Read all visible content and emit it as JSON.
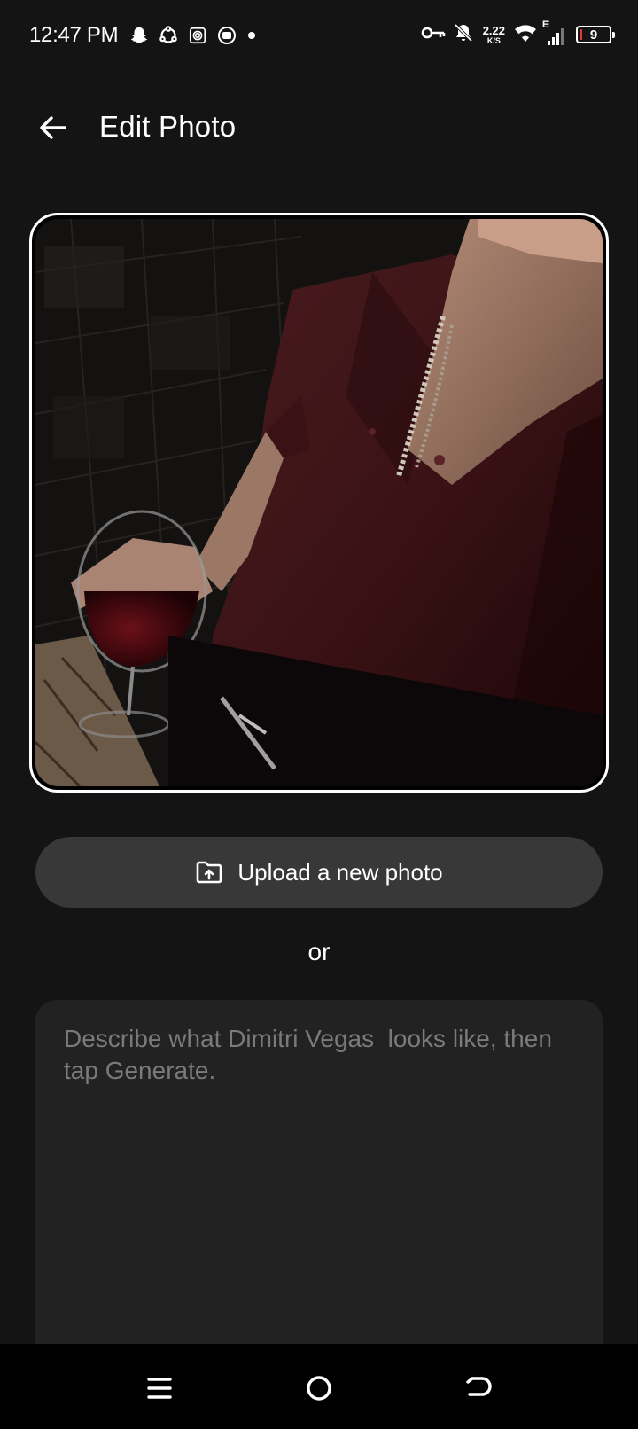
{
  "status_bar": {
    "time": "12:47 PM",
    "notification_icons": [
      "snapchat-icon",
      "sync-icon",
      "fingerprint-icon",
      "media-icon",
      "dot-icon"
    ],
    "network_speed_value": "2.22",
    "network_speed_unit": "K/S",
    "network_type": "E",
    "battery_level": "9",
    "battery_color": "#e53935"
  },
  "header": {
    "title": "Edit Photo",
    "back_icon": "arrow-left-icon"
  },
  "upload": {
    "label": "Upload a new photo",
    "icon": "folder-upload-icon"
  },
  "separator_text": "or",
  "description": {
    "value": "",
    "placeholder": "Describe what Dimitri Vegas  looks like, then tap Generate."
  },
  "nav_bar": {
    "buttons": [
      "menu-icon",
      "home-icon",
      "back-icon"
    ]
  },
  "colors": {
    "background": "#141414",
    "button": "#383838",
    "textarea": "#222222",
    "placeholder": "#7a7a7a"
  }
}
